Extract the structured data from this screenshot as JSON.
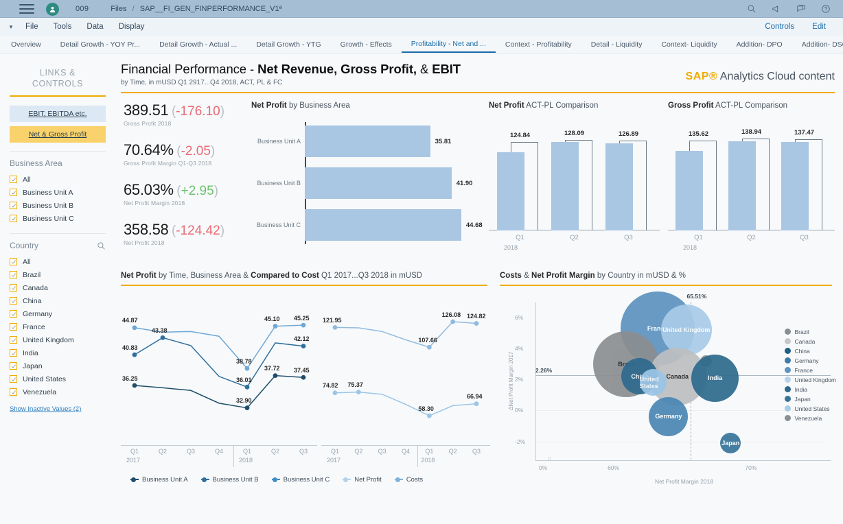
{
  "shell": {
    "menu_icon": "hamburger-icon",
    "avatar_icon": "user-avatar-icon",
    "number": "009",
    "breadcrumb_root": "Files",
    "breadcrumb_sep": "/",
    "breadcrumb_file": "SAP__FI_GEN_FINPERFORMANCE_V1ª",
    "icons": [
      "search-icon",
      "megaphone-icon",
      "collaboration-icon",
      "help-icon"
    ]
  },
  "menubar": {
    "items": [
      "File",
      "Tools",
      "Data",
      "Display"
    ],
    "right_items": [
      "Controls",
      "Edit"
    ]
  },
  "tabs": [
    {
      "label": "Overview",
      "active": false
    },
    {
      "label": "Detail Growth - YOY Pr...",
      "active": false
    },
    {
      "label": "Detail Growth - Actual ...",
      "active": false
    },
    {
      "label": "Detail Growth - YTG",
      "active": false
    },
    {
      "label": "Growth - Effects",
      "active": false
    },
    {
      "label": "Profitability - Net and ...",
      "active": true
    },
    {
      "label": "Context - Profitability",
      "active": false
    },
    {
      "label": "Detail - Liquidity",
      "active": false
    },
    {
      "label": "Context- Liquidity",
      "active": false
    },
    {
      "label": "Addition- DPO",
      "active": false
    },
    {
      "label": "Addition- DSO",
      "active": false
    }
  ],
  "sidebar": {
    "title_line1": "LINKS &",
    "title_line2": "CONTROLS",
    "links": [
      {
        "label": "EBIT, EBITDA etc.",
        "style": "blue"
      },
      {
        "label": "Net & Gross Profit",
        "style": "gold"
      }
    ],
    "business_area": {
      "heading": "Business Area",
      "items": [
        {
          "label": "All",
          "checked": true
        },
        {
          "label": "Business Unit A",
          "checked": true
        },
        {
          "label": "Business Unit B",
          "checked": true
        },
        {
          "label": "Business Unit C",
          "checked": true
        }
      ]
    },
    "country": {
      "heading": "Country",
      "search_icon": "search-icon",
      "items": [
        {
          "label": "All",
          "checked": true
        },
        {
          "label": "Brazil",
          "checked": true
        },
        {
          "label": "Canada",
          "checked": true
        },
        {
          "label": "China",
          "checked": true
        },
        {
          "label": "Germany",
          "checked": true
        },
        {
          "label": "France",
          "checked": true
        },
        {
          "label": "United Kingdom",
          "checked": true
        },
        {
          "label": "India",
          "checked": true
        },
        {
          "label": "Japan",
          "checked": true
        },
        {
          "label": "United States",
          "checked": true
        },
        {
          "label": "Venezuela",
          "checked": true
        }
      ]
    },
    "show_inactive": "Show Inactive Values (2)"
  },
  "header": {
    "title_prefix": "Financial Performance - ",
    "title_bold1": "Net Revenue, Gross Profit,",
    "title_mid": " & ",
    "title_bold2": "EBIT",
    "subtitle": "by Time, in mUSD Q1 2917...Q4 2018, ACT, PL & FC",
    "brand_sap": "SAP®",
    "brand_rest": " Analytics Cloud content"
  },
  "kpis": [
    {
      "value": "389.51",
      "delta": "-176.10",
      "sign": "neg",
      "caption": "Gross Profit 2018"
    },
    {
      "value": "70.64%",
      "delta": "-2.05",
      "sign": "neg",
      "caption": "Gross Profit Margin Q1-Q3 2018"
    },
    {
      "value": "65.03%",
      "delta": "+2.95",
      "sign": "pos",
      "caption": "Net Profit Margin 2018"
    },
    {
      "value": "358.58",
      "delta": "-124.42",
      "sign": "neg",
      "caption": "Net Profit 2018"
    }
  ],
  "chart_data": [
    {
      "id": "net_profit_by_business_area",
      "type": "bar",
      "orientation": "horizontal",
      "title_bold": "Net Profit",
      "title_rest": " by Business Area",
      "categories": [
        "Business Unit A",
        "Business Unit B",
        "Business Unit C"
      ],
      "values": [
        35.81,
        41.9,
        44.68
      ],
      "value_labels": [
        "35.81",
        "41.90",
        "44.68"
      ],
      "xlim": [
        0,
        50
      ],
      "color": "#a9c6e3"
    },
    {
      "id": "net_profit_act_pl",
      "type": "bar",
      "title_bold": "Net Profit",
      "title_rest": " ACT-PL Comparison",
      "categories": [
        "Q1",
        "Q2",
        "Q3"
      ],
      "year": "2018",
      "series": [
        {
          "name": "ACT",
          "values": [
            110.3,
            124.8,
            123.0
          ],
          "style": "filled"
        },
        {
          "name": "PL",
          "values": [
            124.84,
            128.09,
            126.89
          ],
          "style": "outline"
        }
      ],
      "value_labels": [
        "124.84",
        "128.09",
        "126.89"
      ],
      "ylim": [
        0,
        145
      ]
    },
    {
      "id": "gross_profit_act_pl",
      "type": "bar",
      "title_bold": "Gross Profit",
      "title_rest": " ACT-PL Comparison",
      "categories": [
        "Q1",
        "Q2",
        "Q3"
      ],
      "year": "2018",
      "series": [
        {
          "name": "ACT",
          "values": [
            120.0,
            134.5,
            133.0
          ],
          "style": "filled"
        },
        {
          "name": "PL",
          "values": [
            135.62,
            138.94,
            137.47
          ],
          "style": "outline"
        }
      ],
      "value_labels": [
        "135.62",
        "138.94",
        "137.47"
      ],
      "ylim": [
        0,
        155
      ]
    },
    {
      "id": "net_profit_by_time_business_area",
      "type": "line",
      "title_bold1": "Net Profit",
      "title_mid": " by Time, Business Area & ",
      "title_bold2": "Compared to Cost",
      "title_rest": " Q1 2017...Q3 2018 in mUSD",
      "x": [
        "Q1 2017",
        "Q2 2017",
        "Q3 2017",
        "Q4 2017",
        "Q1 2018",
        "Q2 2018",
        "Q3 2018"
      ],
      "xticks": [
        "Q1",
        "Q2",
        "Q3",
        "Q4",
        "Q1",
        "Q2",
        "Q3"
      ],
      "years": [
        "2017",
        "2018"
      ],
      "series": [
        {
          "name": "Business Unit A",
          "color": "#1f4e6b",
          "values": [
            36.25,
            35.9,
            35.5,
            33.6,
            32.9,
            37.72,
            37.45
          ],
          "labels": {
            "0": "36.25",
            "4": "32.90",
            "5": "37.72",
            "6": "37.45"
          }
        },
        {
          "name": "Business Unit B",
          "color": "#2f6f9e",
          "values": [
            40.83,
            43.38,
            42.2,
            37.6,
            36.01,
            42.6,
            42.12
          ],
          "labels": {
            "0": "40.83",
            "1": "43.38",
            "4": "36.01",
            "6": "42.12"
          }
        },
        {
          "name": "Business Unit C",
          "color": "#6fa8d6",
          "values": [
            44.87,
            44.2,
            44.3,
            43.6,
            38.78,
            45.1,
            45.25
          ],
          "labels": {
            "0": "44.87",
            "4": "38.78",
            "5": "45.10",
            "6": "45.25"
          }
        }
      ],
      "ylim": [
        30,
        47
      ]
    },
    {
      "id": "net_profit_vs_costs",
      "type": "line",
      "x": [
        "Q1 2017",
        "Q2 2017",
        "Q3 2017",
        "Q4 2017",
        "Q1 2018",
        "Q2 2018",
        "Q3 2018"
      ],
      "xticks": [
        "Q1",
        "Q2",
        "Q3",
        "Q4",
        "Q1",
        "Q2",
        "Q3"
      ],
      "years": [
        "2017",
        "2018"
      ],
      "series": [
        {
          "name": "Costs",
          "color": "#8fbade",
          "values": [
            121.95,
            121.6,
            119.0,
            113.0,
            107.66,
            126.08,
            124.82
          ],
          "labels": {
            "0": "121.95",
            "4": "107.66",
            "5": "126.08",
            "6": "124.82"
          }
        },
        {
          "name": "Net Profit",
          "color": "#9cc5e6",
          "values": [
            74.82,
            75.37,
            73.8,
            66.5,
            58.3,
            65.6,
            66.94
          ],
          "labels": {
            "0": "74.82",
            "1": "75.37",
            "4": "58.30",
            "6": "66.94"
          }
        }
      ],
      "ylim": [
        50,
        132
      ]
    },
    {
      "id": "costs_and_net_profit_margin_by_country",
      "type": "scatter",
      "title_bold1": "Costs",
      "title_mid": " & ",
      "title_bold2": "Net Profit Margin",
      "title_rest": " by Country in mUSD & %",
      "xlabel": "Net Profit Margin 2018",
      "ylabel": "ΔNet Profit Margin 2017",
      "xticks": [
        "0%",
        "60%",
        "70%"
      ],
      "yticks": [
        "6%",
        "4%",
        "2%",
        "0%",
        "-2%"
      ],
      "ref_x_label": "65.51%",
      "ref_y_label": "2.26%",
      "points": [
        {
          "label": "France",
          "x": 64.0,
          "y": 5.3,
          "size": 108,
          "color": "#5d93bf",
          "text": "#ffffff"
        },
        {
          "label": "United Kingdom",
          "x": 65.3,
          "y": 5.2,
          "size": 74,
          "color": "#a8cbe8",
          "text": "#ffffff"
        },
        {
          "label": "Brazil",
          "x": 62.6,
          "y": 3.0,
          "size": 96,
          "color": "#8b8e90",
          "text": "#1a1a1a"
        },
        {
          "label": "Canada",
          "x": 64.9,
          "y": 2.2,
          "size": 84,
          "color": "#bdbfc1",
          "text": "#1a1a1a"
        },
        {
          "label": "China",
          "x": 63.2,
          "y": 2.2,
          "size": 53,
          "color": "#2f6a8e",
          "text": "#ffffff"
        },
        {
          "label": "United States",
          "x": 63.8,
          "y": 1.8,
          "size": 39,
          "color": "#9cc5e6",
          "text": "#ffffff"
        },
        {
          "label": "Venezuela",
          "x": 66.2,
          "y": 3.2,
          "size": 17,
          "color": "#8b8e90",
          "text": "#1a1a1a"
        },
        {
          "label": "India",
          "x": 66.6,
          "y": 2.1,
          "size": 69,
          "color": "#2e6a8d",
          "text": "#ffffff"
        },
        {
          "label": "Germany",
          "x": 64.5,
          "y": -0.4,
          "size": 57,
          "color": "#4a87b3",
          "text": "#ffffff"
        },
        {
          "label": "Japan",
          "x": 67.3,
          "y": -2.1,
          "size": 30,
          "color": "#38749a",
          "text": "#ffffff"
        }
      ],
      "legend": [
        {
          "label": "Brazil",
          "color": "#8b8e90"
        },
        {
          "label": "Canada",
          "color": "#c5c7c9"
        },
        {
          "label": "China",
          "color": "#1f5e85"
        },
        {
          "label": "Germany",
          "color": "#3f7ba6"
        },
        {
          "label": "France",
          "color": "#5d93bf"
        },
        {
          "label": "United Kingdom",
          "color": "#b7d3ec"
        },
        {
          "label": "India",
          "color": "#2e6a8d"
        },
        {
          "label": "Japan",
          "color": "#38749a"
        },
        {
          "label": "United States",
          "color": "#a8cbe8"
        },
        {
          "label": "Venezuela",
          "color": "#8b8e90"
        }
      ]
    }
  ],
  "legends": {
    "line_chart": [
      {
        "label": "Business Unit A",
        "color": "#1f4e6b"
      },
      {
        "label": "Business Unit B",
        "color": "#2f6f9e"
      },
      {
        "label": "Business Unit C",
        "color": "#3f8ec4"
      },
      {
        "label": "Net Profit",
        "color": "#b4d3ea"
      },
      {
        "label": "Costs",
        "color": "#7fb2da"
      }
    ]
  }
}
